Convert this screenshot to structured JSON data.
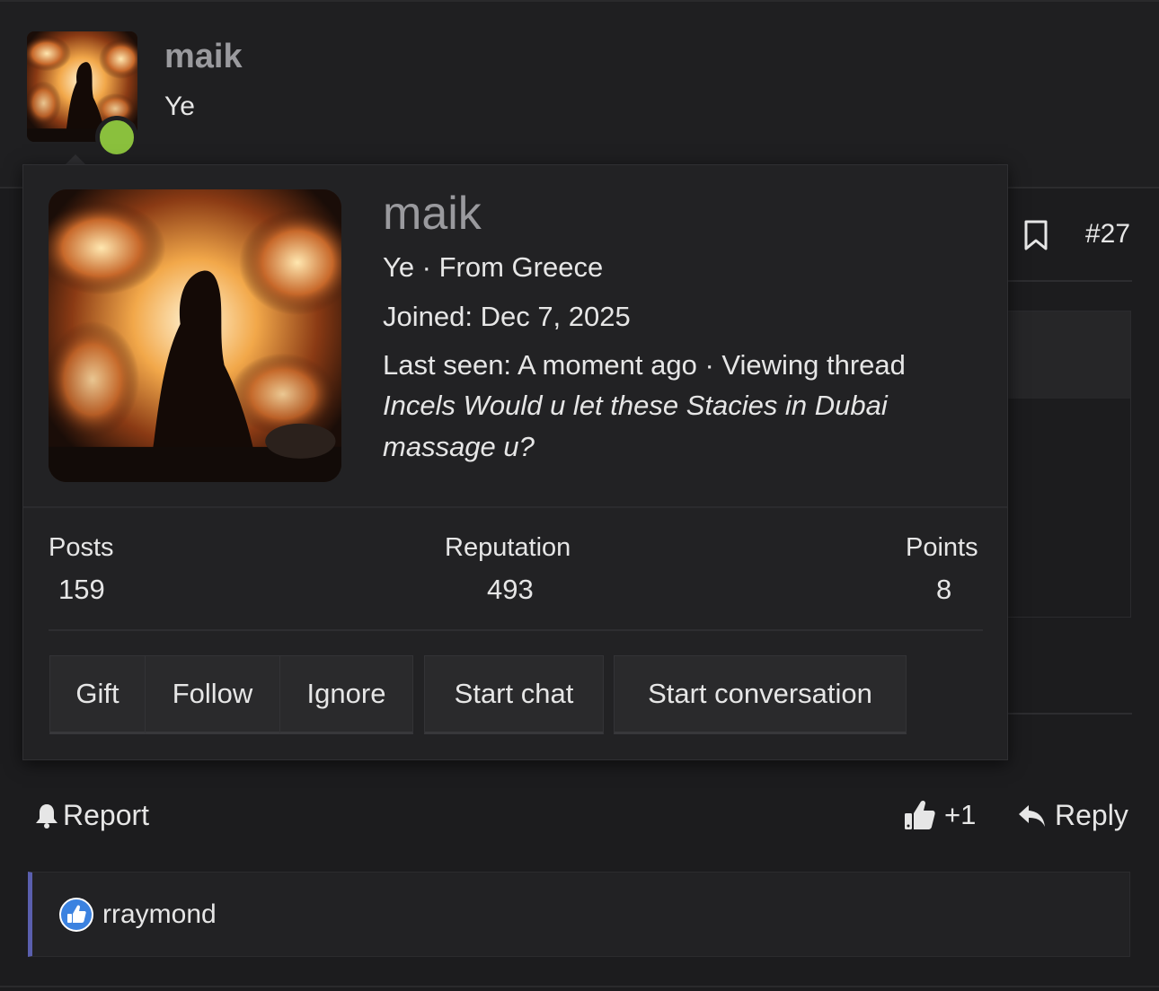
{
  "post": {
    "username": "maik",
    "user_title": "Ye",
    "post_number": "#27",
    "report_label": "Report",
    "like_count": "+1",
    "reply_label": "Reply"
  },
  "popup": {
    "username": "maik",
    "title_location": "Ye · From Greece",
    "joined": "Joined: Dec 7, 2025",
    "last_seen": "Last seen: A moment ago · Viewing thread",
    "thread_title_line1": "Incels Would u let these Stacies in Dubai",
    "thread_title_line2": "massage u?",
    "stats": [
      {
        "label": "Posts",
        "value": "159"
      },
      {
        "label": "Reputation",
        "value": "493"
      },
      {
        "label": "Points",
        "value": "8"
      }
    ],
    "buttons": [
      "Gift",
      "Follow",
      "Ignore",
      "Start chat",
      "Start conversation"
    ]
  },
  "reactions": {
    "users": "rraymond",
    "icon": "thumbs-up-icon"
  },
  "colors": {
    "background": "#1c1c1e",
    "online": "#8ac03d",
    "reaction_accent": "#5a5fae",
    "like_blue": "#3b82e0"
  }
}
